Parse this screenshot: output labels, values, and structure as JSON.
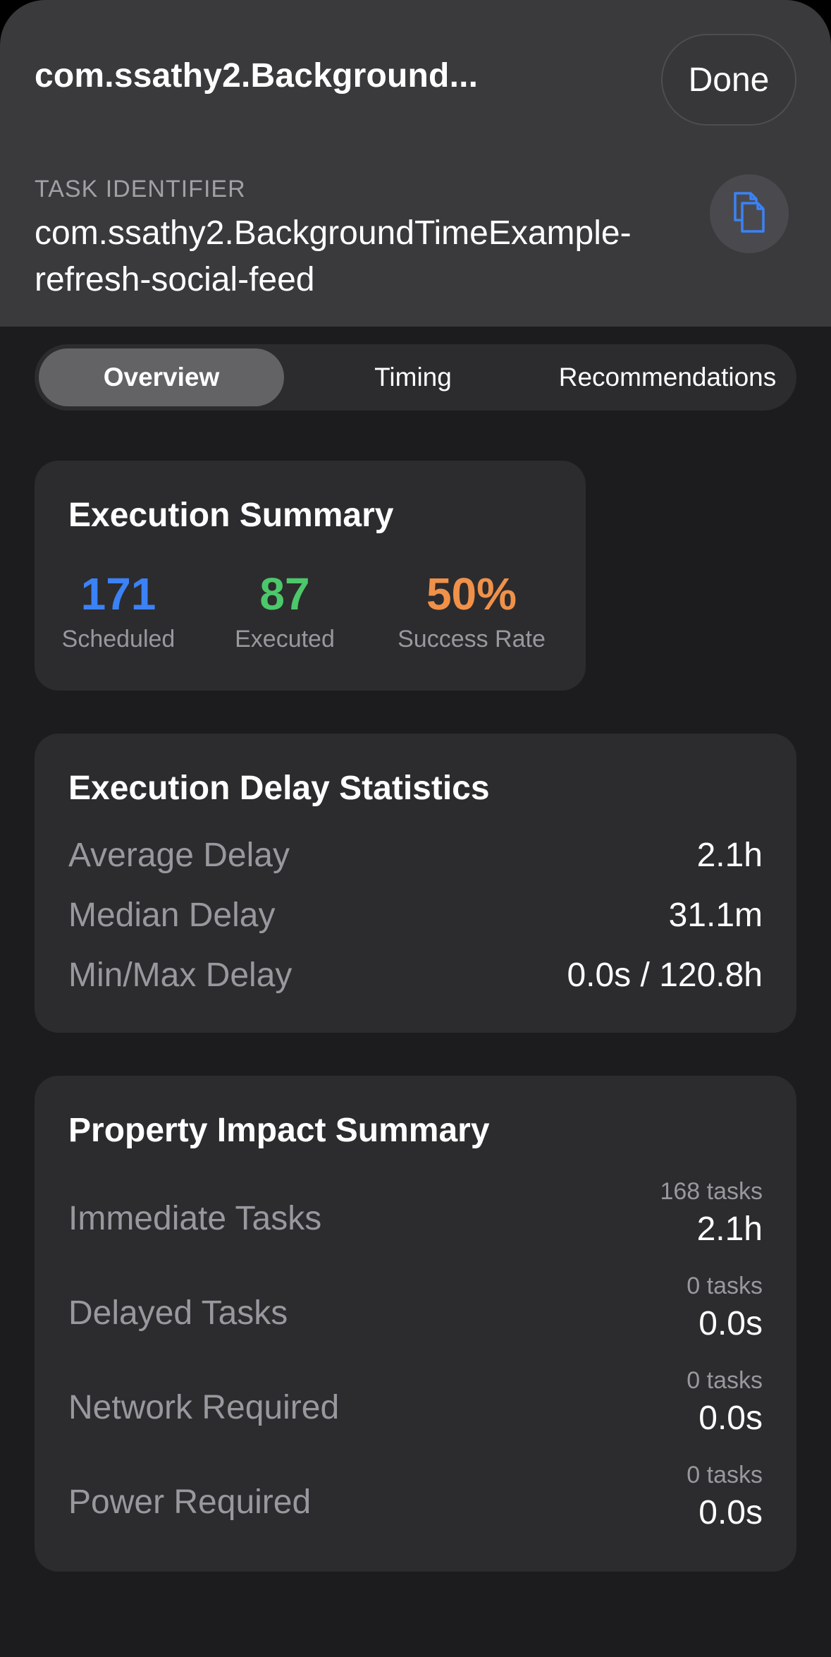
{
  "header": {
    "title": "com.ssathy2.Background...",
    "done_label": "Done",
    "task_identifier_label": "TASK IDENTIFIER",
    "task_identifier_value": "com.ssathy2.BackgroundTimeExample-refresh-social-feed",
    "copy_icon": "copy-icon"
  },
  "tabs": [
    {
      "label": "Overview",
      "selected": true
    },
    {
      "label": "Timing",
      "selected": false
    },
    {
      "label": "Recommendations",
      "selected": false
    }
  ],
  "execution_summary": {
    "title": "Execution Summary",
    "stats": [
      {
        "value": "171",
        "label": "Scheduled",
        "color": "#3b82f6"
      },
      {
        "value": "87",
        "label": "Executed",
        "color": "#4cc86a"
      },
      {
        "value": "50%",
        "label": "Success Rate",
        "color": "#f0914a"
      }
    ]
  },
  "delay_statistics": {
    "title": "Execution Delay Statistics",
    "rows": [
      {
        "label": "Average Delay",
        "value": "2.1h"
      },
      {
        "label": "Median Delay",
        "value": "31.1m"
      },
      {
        "label": "Min/Max Delay",
        "value": "0.0s / 120.8h"
      }
    ]
  },
  "property_impact": {
    "title": "Property Impact Summary",
    "rows": [
      {
        "label": "Immediate Tasks",
        "count": "168 tasks",
        "value": "2.1h"
      },
      {
        "label": "Delayed Tasks",
        "count": "0 tasks",
        "value": "0.0s"
      },
      {
        "label": "Network Required",
        "count": "0 tasks",
        "value": "0.0s"
      },
      {
        "label": "Power Required",
        "count": "0 tasks",
        "value": "0.0s"
      }
    ]
  }
}
